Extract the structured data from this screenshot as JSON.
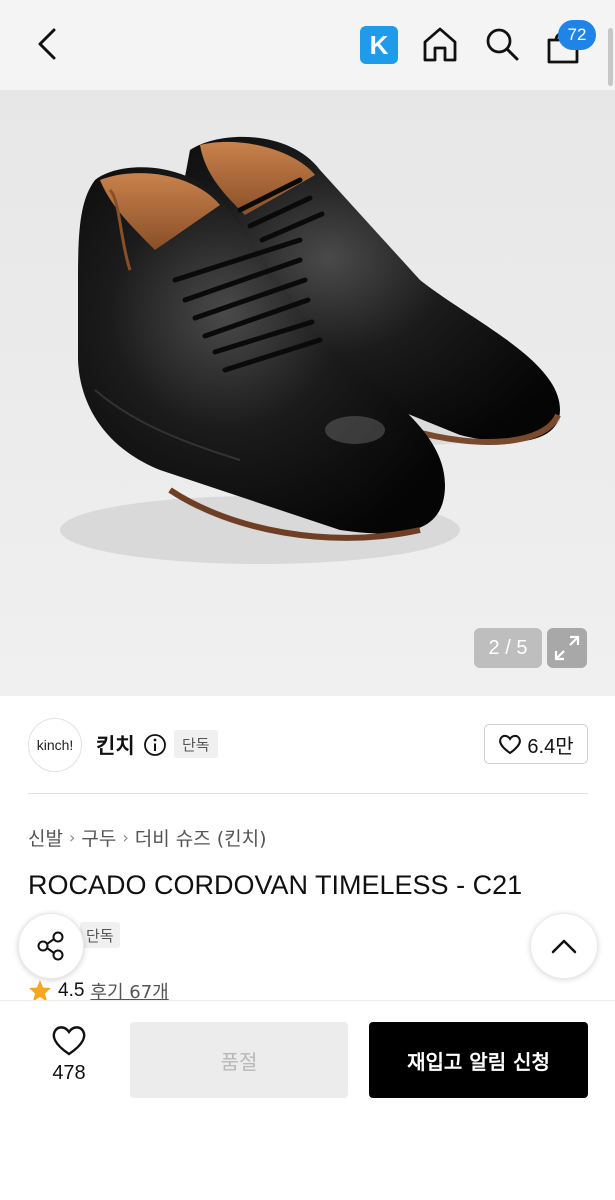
{
  "header": {
    "k_label": "K",
    "cart_count": "72"
  },
  "gallery": {
    "counter": "2 / 5"
  },
  "brand": {
    "logo_text": "kinch!",
    "name": "킨치",
    "badge": "단독",
    "likes": "6.4만"
  },
  "breadcrumb": [
    "신발",
    "구두",
    "더비 슈즈 (킨치)"
  ],
  "product": {
    "title": "ROCADO CORDOVAN TIMELESS - C21",
    "badge": "단독",
    "rating": "4.5",
    "review_label": "후기 67개"
  },
  "bottom": {
    "wish_count": "478",
    "soldout_label": "품절",
    "restock_label": "재입고 알림 신청"
  },
  "colors": {
    "accent": "#1e9be9",
    "badge": "#1e84e8",
    "star": "#f5a623"
  },
  "icons": [
    "chevron-left-icon",
    "home-icon",
    "search-icon",
    "cart-icon",
    "expand-icon",
    "info-icon",
    "heart-icon",
    "share-icon",
    "chevron-up-icon",
    "star-icon"
  ]
}
